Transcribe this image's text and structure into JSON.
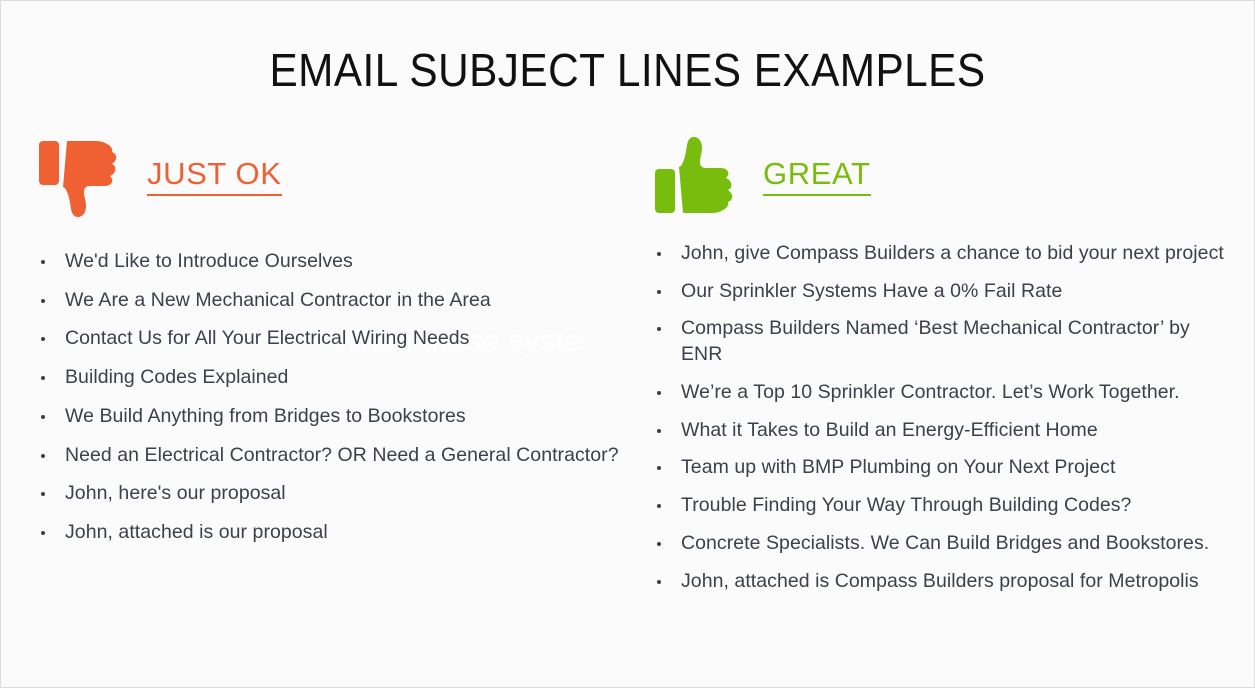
{
  "slide": {
    "title": "EMAIL SUBJECT LINES EXAMPLES",
    "watermark": "When those syste",
    "background_color": "#fbfbfc",
    "border_color": "#dcdcdc",
    "text_color": "#3a414c"
  },
  "columns": {
    "left": {
      "icon": "thumbs-down-icon",
      "label": "JUST OK",
      "accent_color": "#ef6033",
      "items": [
        "We'd Like to Introduce Ourselves",
        "We Are a New Mechanical Contractor in the Area",
        "Contact Us for All Your Electrical Wiring Needs",
        "Building Codes Explained",
        "We Build Anything from Bridges to Bookstores",
        "Need an Electrical Contractor? OR Need a General Contractor?",
        "John, here's our proposal",
        "John, attached is our proposal"
      ]
    },
    "right": {
      "icon": "thumbs-up-icon",
      "label": "GREAT",
      "accent_color": "#78bd0d",
      "items": [
        "John, give Compass Builders a chance to bid your next project",
        "Our Sprinkler Systems Have a 0% Fail Rate",
        "Compass Builders Named ‘Best Mechanical Contractor’ by ENR",
        "We’re a Top 10 Sprinkler Contractor. Let’s Work Together.",
        "What it Takes to Build an Energy-Efficient Home",
        "Team up with BMP Plumbing on Your Next Project",
        "Trouble Finding Your Way Through Building Codes?",
        "Concrete Specialists. We Can Build Bridges and Bookstores.",
        "John, attached is Compass Builders proposal for Metropolis"
      ]
    }
  }
}
